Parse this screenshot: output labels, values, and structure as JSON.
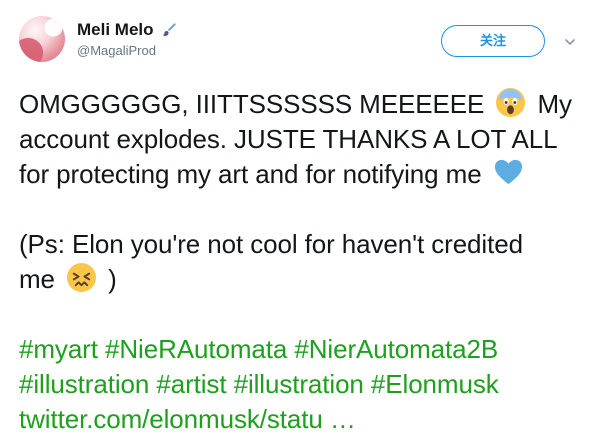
{
  "user": {
    "display_name": "Meli Melo",
    "handle": "@MagaliProd"
  },
  "actions": {
    "follow_label": "关注"
  },
  "tweet": {
    "line1_before": "OMGGGGGG, IIITTSSSSSS MEEEEEE",
    "line1_after": "My",
    "line2": "account explodes. JUSTE THANKS A LOT ALL",
    "line3_before": "for protecting my art and for notifying me",
    "line5": "(Ps: Elon you're not cool for haven't credited",
    "line6_before": "me",
    "line6_after": ")",
    "hashtag_line1": [
      "#myart",
      "#NieRAutomata",
      "#NierAutomata2B"
    ],
    "hashtag_line2": [
      "#illustration",
      "#artist",
      "#illustration",
      "#Elonmusk"
    ],
    "link_text": "twitter.com/elonmusk/statu …"
  },
  "icons": {
    "brush": "paintbrush-icon",
    "scream": "scream-emoji-icon",
    "heart": "blue-heart-icon",
    "confounded": "confounded-face-emoji-icon",
    "caret": "chevron-down-icon"
  },
  "colors": {
    "accent": "#1b95e0",
    "hashtag": "#1e9f1e",
    "secondary_text": "#657786"
  }
}
